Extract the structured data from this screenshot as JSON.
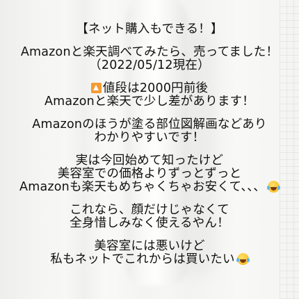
{
  "lines": {
    "l1": "【ネット購入もできる！】",
    "l2": "Amazonと楽天調べてみたら、売ってました！",
    "l3": "（2022/05/12現在）",
    "l4": "値段は2000円前後",
    "l5": "Amazonと楽天で少し差があります！",
    "l6": "Amazonのほうが塗る部位図解画などあり",
    "l7": "わかりやすいです！",
    "l8": "実は今回始めて知ったけど",
    "l9": "美容室での価格よりずっとずっと",
    "l10": "Amazonも楽天もめちゃくちゃお安くて、、、",
    "l11": "これなら、顔だけじゃなくて",
    "l12": "全身惜しみなく使えるやん！",
    "l13": "美容室には悪いけど",
    "l14": "私もネットでこれからは買いたい"
  },
  "icons": {
    "warning": "up-triangle-icon",
    "laugh": "tears-of-joy-emoji-icon"
  },
  "colors": {
    "text": "#111111",
    "icon_orange": "#f39c34",
    "background": "#f5f5f3"
  }
}
